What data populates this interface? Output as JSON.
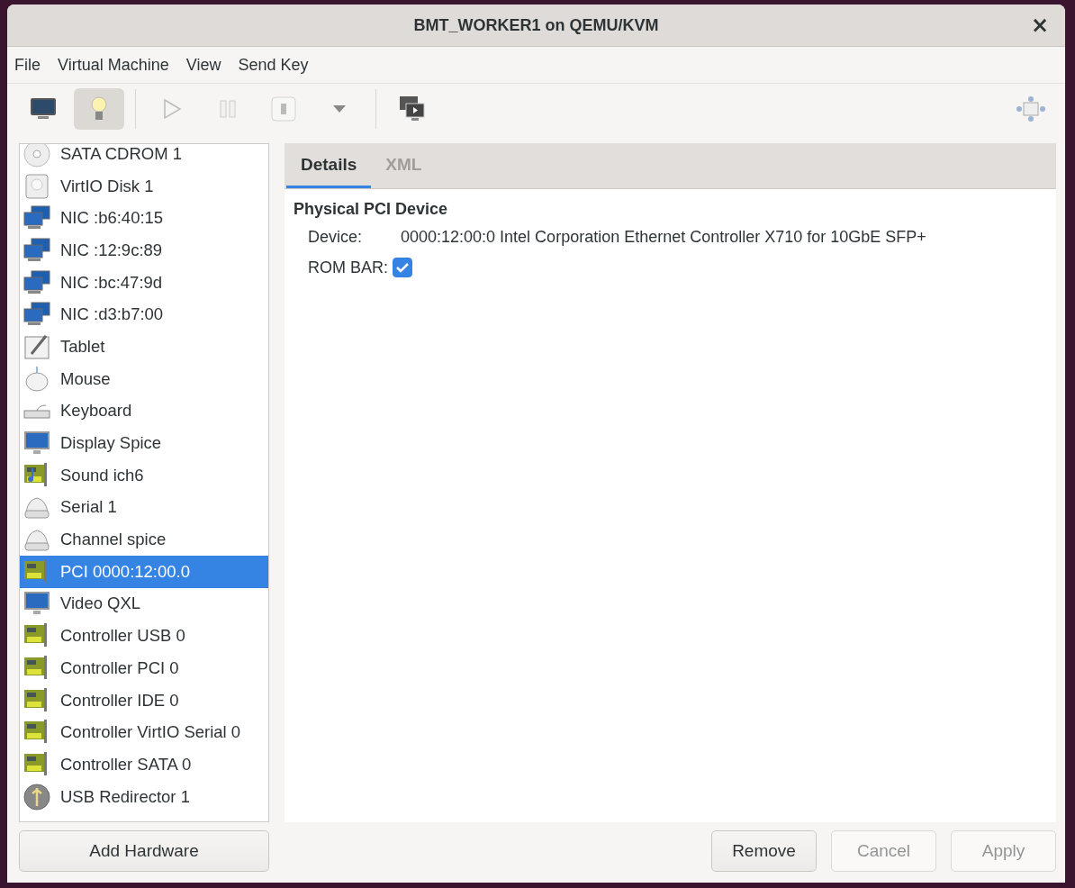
{
  "window": {
    "title": "BMT_WORKER1 on QEMU/KVM",
    "close": "×"
  },
  "menu": [
    "File",
    "Virtual Machine",
    "View",
    "Send Key"
  ],
  "toolbar": [
    {
      "kind": "console",
      "selected": false,
      "disabled": false
    },
    {
      "kind": "details",
      "selected": true,
      "disabled": false
    },
    {
      "kind": "separator"
    },
    {
      "kind": "run",
      "selected": false,
      "disabled": true
    },
    {
      "kind": "pause",
      "selected": false,
      "disabled": true
    },
    {
      "kind": "shutdown",
      "selected": false,
      "disabled": true
    },
    {
      "kind": "dropdown",
      "selected": false,
      "disabled": false
    },
    {
      "kind": "separator"
    },
    {
      "kind": "snapshots",
      "selected": false,
      "disabled": false
    },
    {
      "kind": "spacer"
    },
    {
      "kind": "fullscreen",
      "selected": false,
      "disabled": false
    }
  ],
  "sidebar": {
    "items": [
      {
        "kind": "cdrom",
        "label": "SATA CDROM 1",
        "selected": false
      },
      {
        "kind": "disk",
        "label": "VirtIO Disk 1",
        "selected": false
      },
      {
        "kind": "nic",
        "label": "NIC :b6:40:15",
        "selected": false
      },
      {
        "kind": "nic",
        "label": "NIC :12:9c:89",
        "selected": false
      },
      {
        "kind": "nic",
        "label": "NIC :bc:47:9d",
        "selected": false
      },
      {
        "kind": "nic",
        "label": "NIC :d3:b7:00",
        "selected": false
      },
      {
        "kind": "tablet",
        "label": "Tablet",
        "selected": false
      },
      {
        "kind": "mouse",
        "label": "Mouse",
        "selected": false
      },
      {
        "kind": "keyboard",
        "label": "Keyboard",
        "selected": false
      },
      {
        "kind": "display",
        "label": "Display Spice",
        "selected": false
      },
      {
        "kind": "sound",
        "label": "Sound ich6",
        "selected": false
      },
      {
        "kind": "serial",
        "label": "Serial 1",
        "selected": false
      },
      {
        "kind": "serial",
        "label": "Channel spice",
        "selected": false
      },
      {
        "kind": "pci",
        "label": "PCI 0000:12:00.0",
        "selected": true
      },
      {
        "kind": "display",
        "label": "Video QXL",
        "selected": false
      },
      {
        "kind": "pci",
        "label": "Controller USB 0",
        "selected": false
      },
      {
        "kind": "pci",
        "label": "Controller PCI 0",
        "selected": false
      },
      {
        "kind": "pci",
        "label": "Controller IDE 0",
        "selected": false
      },
      {
        "kind": "pci",
        "label": "Controller VirtIO Serial 0",
        "selected": false
      },
      {
        "kind": "pci",
        "label": "Controller SATA 0",
        "selected": false
      },
      {
        "kind": "usb",
        "label": "USB Redirector 1",
        "selected": false
      }
    ],
    "add_button": "Add Hardware"
  },
  "tabs": [
    {
      "label": "Details",
      "selected": true
    },
    {
      "label": "XML",
      "selected": false
    }
  ],
  "details": {
    "heading": "Physical PCI Device",
    "fields": [
      {
        "kind": "text",
        "label": "Device:",
        "value": "0000:12:00:0 Intel Corporation Ethernet Controller X710 for 10GbE SFP+"
      },
      {
        "kind": "checkbox",
        "label": "ROM BAR:",
        "checked": true
      }
    ]
  },
  "buttons": [
    {
      "label": "Remove",
      "disabled": false
    },
    {
      "label": "Cancel",
      "disabled": true
    },
    {
      "label": "Apply",
      "disabled": true
    }
  ]
}
